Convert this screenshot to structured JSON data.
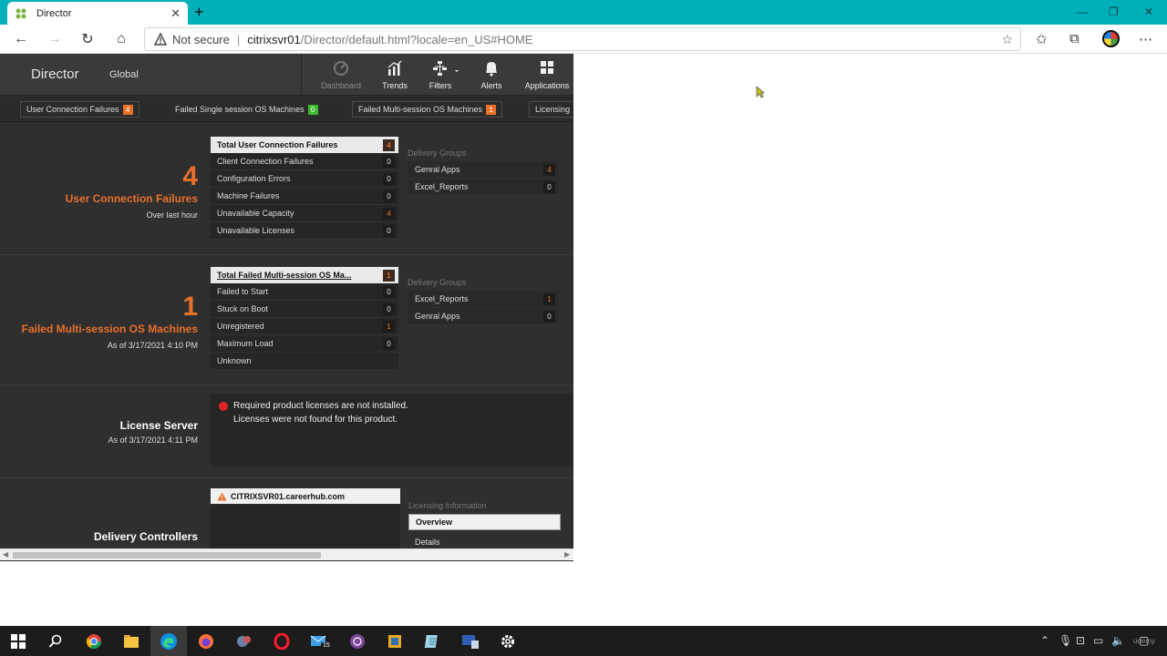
{
  "browser": {
    "tab_title": "Director",
    "new_tab": "+",
    "not_secure": "Not secure",
    "separator": "|",
    "url_host": "citrixsvr01",
    "url_path": "/Director/default.html?locale=en_US#HOME"
  },
  "app": {
    "brand": "Director",
    "scope": "Global",
    "nav": [
      {
        "label": "Dashboard",
        "icon": "dashboard-icon"
      },
      {
        "label": "Trends",
        "icon": "trends-icon"
      },
      {
        "label": "Filters",
        "icon": "filters-icon"
      },
      {
        "label": "Alerts",
        "icon": "bell-icon"
      },
      {
        "label": "Applications",
        "icon": "applications-grid-icon"
      }
    ],
    "filter_tabs": [
      {
        "label": "User Connection Failures",
        "count": "4"
      },
      {
        "label": "Failed Single session OS Machines",
        "count": "0"
      },
      {
        "label": "Failed Multi-session OS Machines",
        "count": "1"
      },
      {
        "label": "Licensing"
      }
    ]
  },
  "ucf": {
    "count": "4",
    "title": "User Connection Failures",
    "subtitle": "Over last hour",
    "panel_head": "Total User Connection Failures",
    "panel_head_count": "4",
    "rows": [
      {
        "label": "Client Connection Failures",
        "count": "0"
      },
      {
        "label": "Configuration Errors",
        "count": "0"
      },
      {
        "label": "Machine Failures",
        "count": "0"
      },
      {
        "label": "Unavailable Capacity",
        "count": "4"
      },
      {
        "label": "Unavailable Licenses",
        "count": "0"
      }
    ],
    "dg_title": "Delivery Groups",
    "dg_rows": [
      {
        "label": "Genral Apps",
        "count": "4"
      },
      {
        "label": "Excel_Reports",
        "count": "0"
      }
    ]
  },
  "fmm": {
    "count": "1",
    "title": "Failed Multi-session OS Machines",
    "subtitle": "As of 3/17/2021 4:10 PM",
    "panel_head": "Total Failed Multi-session OS Ma...",
    "panel_head_count": "1",
    "rows": [
      {
        "label": "Failed to Start",
        "count": "0"
      },
      {
        "label": "Stuck on Boot",
        "count": "0"
      },
      {
        "label": "Unregistered",
        "count": "1"
      },
      {
        "label": "Maximum Load",
        "count": "0"
      },
      {
        "label": "Unknown",
        "count": ""
      }
    ],
    "dg_title": "Delivery Groups",
    "dg_rows": [
      {
        "label": "Excel_Reports",
        "count": "1"
      },
      {
        "label": "Genral Apps",
        "count": "0"
      }
    ]
  },
  "license": {
    "title": "License Server",
    "subtitle": "As of 3/17/2021 4:11 PM",
    "line1": "Required product licenses are not installed.",
    "line2": "Licenses were not found for this product."
  },
  "dc": {
    "title": "Delivery Controllers",
    "server": "CITRIXSVR01.careerhub.com",
    "info_title": "Licensing Information",
    "overview": "Overview",
    "details": "Details"
  },
  "colors": {
    "accent_orange": "#e8702a",
    "badge_green": "#3dbb2f",
    "error_red": "#e02424",
    "browser_teal": "#00b0b9"
  },
  "taskbar": {
    "mail_badge": "15",
    "watermark": "udemy"
  }
}
